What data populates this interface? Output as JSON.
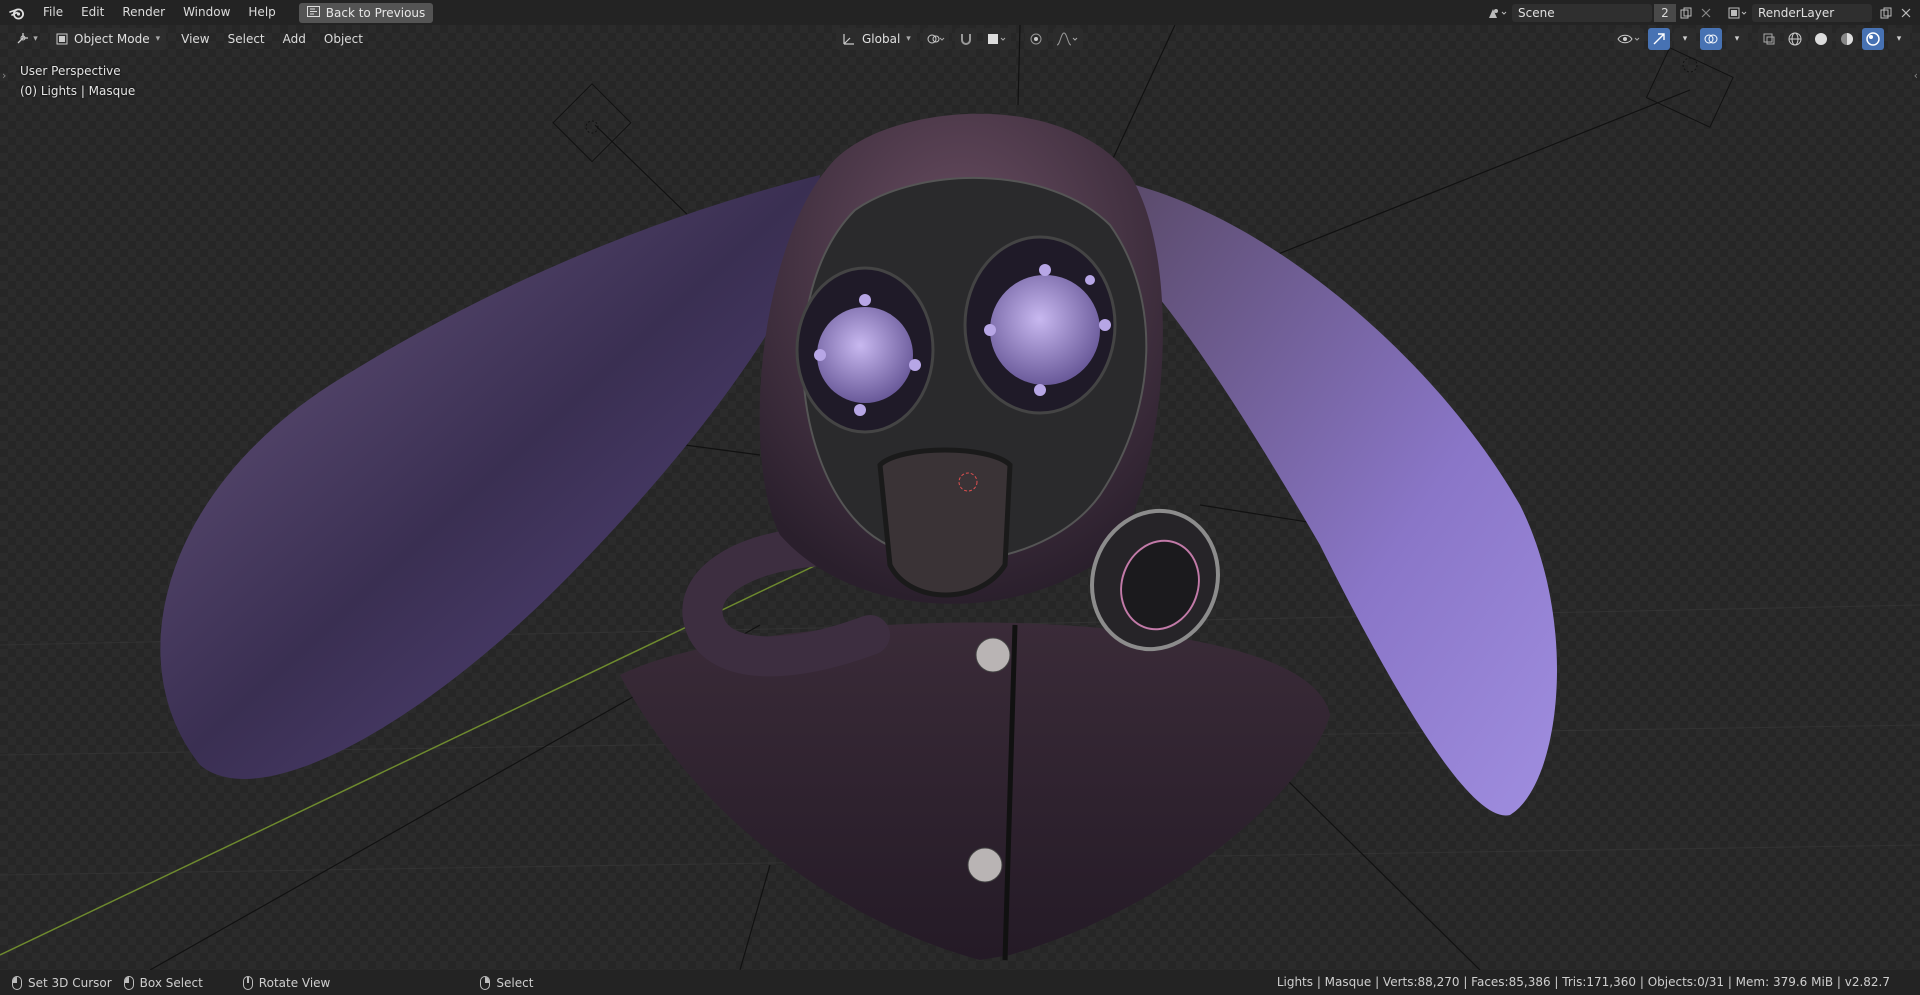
{
  "menubar": {
    "logo": "blender-logo",
    "items": [
      "File",
      "Edit",
      "Render",
      "Window",
      "Help"
    ],
    "back_button": "Back to Previous"
  },
  "scene": {
    "name": "Scene",
    "users": "2",
    "render_layer": "RenderLayer"
  },
  "header": {
    "mode": "Object Mode",
    "menus": [
      "View",
      "Select",
      "Add",
      "Object"
    ],
    "orientation": "Global"
  },
  "viewport": {
    "perspective": "User Perspective",
    "object_info": "(0) Lights | Masque"
  },
  "statusbar": {
    "hints": [
      {
        "label": "Set 3D Cursor",
        "icon": "mouse-left-icon"
      },
      {
        "label": "Box Select",
        "icon": "mouse-drag-icon"
      },
      {
        "label": "Rotate View",
        "icon": "mouse-middle-icon"
      },
      {
        "label": "Select",
        "icon": "mouse-right-icon"
      }
    ],
    "stats": "Lights | Masque | Verts:88,270 | Faces:85,386 | Tris:171,360 | Objects:0/31 | Mem: 379.6 MiB | v2.82.7"
  },
  "colors": {
    "topbar": "#232323",
    "accent": "#4772b3",
    "viewport_bg": "#2b2b2b"
  }
}
